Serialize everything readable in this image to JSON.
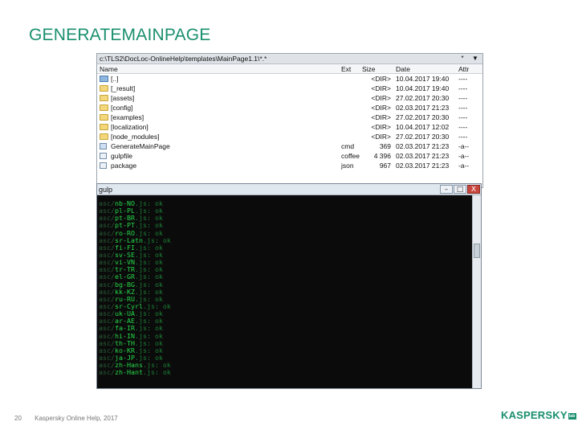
{
  "slide": {
    "title": "GENERATEMAINPAGE",
    "page_number": "20",
    "footer_text": "Kaspersky Online Help, 2017",
    "logo": "KASPERSKY",
    "logo_badge": "lab"
  },
  "file_manager": {
    "path": "c:\\TLS2\\DocLoc-OnlineHelp\\templates\\MainPage1.1\\*.*",
    "path_buttons": [
      "*",
      "▼"
    ],
    "columns": {
      "name": "Name",
      "ext": "Ext",
      "size": "Size",
      "date": "Date",
      "attr": "Attr"
    },
    "rows": [
      {
        "name": "[..]",
        "ext": "",
        "size": "<DIR>",
        "date": "10.04.2017 19:40",
        "attr": "----",
        "type": "up"
      },
      {
        "name": "[_result]",
        "ext": "",
        "size": "<DIR>",
        "date": "10.04.2017 19:40",
        "attr": "----",
        "type": "folder"
      },
      {
        "name": "[assets]",
        "ext": "",
        "size": "<DIR>",
        "date": "27.02.2017 20:30",
        "attr": "----",
        "type": "folder"
      },
      {
        "name": "[config]",
        "ext": "",
        "size": "<DIR>",
        "date": "02.03.2017 21:23",
        "attr": "----",
        "type": "folder"
      },
      {
        "name": "[examples]",
        "ext": "",
        "size": "<DIR>",
        "date": "27.02.2017 20:30",
        "attr": "----",
        "type": "folder"
      },
      {
        "name": "[localization]",
        "ext": "",
        "size": "<DIR>",
        "date": "10.04.2017 12:02",
        "attr": "----",
        "type": "folder"
      },
      {
        "name": "[node_modules]",
        "ext": "",
        "size": "<DIR>",
        "date": "27.02.2017 20:30",
        "attr": "----",
        "type": "folder"
      },
      {
        "name": "GenerateMainPage",
        "ext": "cmd",
        "size": "369",
        "date": "02.03.2017 21:23",
        "attr": "-a--",
        "type": "file-gen"
      },
      {
        "name": "gulpfile",
        "ext": "coffee",
        "size": "4 396",
        "date": "02.03.2017 21:23",
        "attr": "-a--",
        "type": "file"
      },
      {
        "name": "package",
        "ext": "json",
        "size": "967",
        "date": "02.03.2017 21:23",
        "attr": "-a--",
        "type": "file"
      }
    ]
  },
  "console": {
    "title": "gulp",
    "buttons": {
      "minimize": "–",
      "maximize": "□",
      "close": "X"
    },
    "lines": [
      {
        "prefix": "asc/",
        "locale": "nb-NO",
        "suffix": ".js: ok"
      },
      {
        "prefix": "asc/",
        "locale": "pl-PL",
        "suffix": ".js: ok"
      },
      {
        "prefix": "asc/",
        "locale": "pt-BR",
        "suffix": ".js: ok"
      },
      {
        "prefix": "asc/",
        "locale": "pt-PT",
        "suffix": ".js: ok"
      },
      {
        "prefix": "asc/",
        "locale": "ro-RO",
        "suffix": ".js: ok"
      },
      {
        "prefix": "asc/",
        "locale": "sr-Latn",
        "suffix": ".js: ok"
      },
      {
        "prefix": "asc/",
        "locale": "fi-FI",
        "suffix": ".js: ok"
      },
      {
        "prefix": "asc/",
        "locale": "sv-SE",
        "suffix": ".js: ok"
      },
      {
        "prefix": "asc/",
        "locale": "vi-VN",
        "suffix": ".js: ok"
      },
      {
        "prefix": "asc/",
        "locale": "tr-TR",
        "suffix": ".js: ok"
      },
      {
        "prefix": "asc/",
        "locale": "el-GR",
        "suffix": ".js: ok"
      },
      {
        "prefix": "asc/",
        "locale": "bg-BG",
        "suffix": ".js: ok"
      },
      {
        "prefix": "asc/",
        "locale": "kk-KZ",
        "suffix": ".js: ok"
      },
      {
        "prefix": "asc/",
        "locale": "ru-RU",
        "suffix": ".js: ok"
      },
      {
        "prefix": "asc/",
        "locale": "sr-Cyrl",
        "suffix": ".js: ok"
      },
      {
        "prefix": "asc/",
        "locale": "uk-UA",
        "suffix": ".js: ok"
      },
      {
        "prefix": "asc/",
        "locale": "ar-AE",
        "suffix": ".js: ok"
      },
      {
        "prefix": "asc/",
        "locale": "fa-IR",
        "suffix": ".js: ok"
      },
      {
        "prefix": "asc/",
        "locale": "hi-IN",
        "suffix": ".js: ok"
      },
      {
        "prefix": "asc/",
        "locale": "th-TH",
        "suffix": ".js: ok"
      },
      {
        "prefix": "asc/",
        "locale": "ko-KR",
        "suffix": ".js: ok"
      },
      {
        "prefix": "asc/",
        "locale": "ja-JP",
        "suffix": ".js: ok"
      },
      {
        "prefix": "asc/",
        "locale": "zh-Hans",
        "suffix": ".js: ok"
      },
      {
        "prefix": "asc/",
        "locale": "zh-Hant",
        "suffix": ".js: ok"
      }
    ]
  }
}
